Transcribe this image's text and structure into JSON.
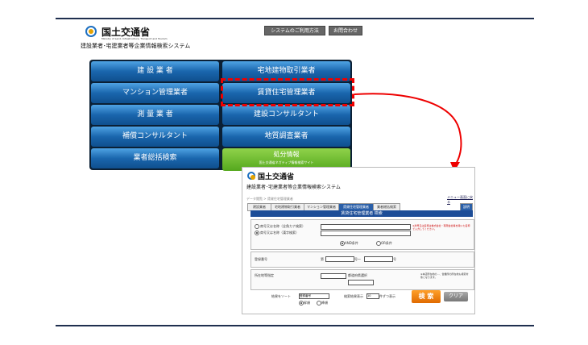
{
  "header": {
    "ministry_name": "国土交通省",
    "ministry_en": "Ministry of Land, Infrastructure, Transport and Tourism",
    "system_name": "建設業者･宅建業者等企業情報検索システム",
    "btn_usage": "システムのご利用方法",
    "btn_contact": "お問合わせ"
  },
  "menu": [
    {
      "label": "建 設 業 者"
    },
    {
      "label": "宅地建物取引業者"
    },
    {
      "label": "マンション管理業者"
    },
    {
      "label": "賃貸住宅管理業者"
    },
    {
      "label": "測 量 業 者"
    },
    {
      "label": "建設コンサルタント"
    },
    {
      "label": "補償コンサルタント"
    },
    {
      "label": "地質調査業者"
    },
    {
      "label": "業者総括検索"
    }
  ],
  "disposal": {
    "title": "処分情報",
    "sub": "国土交通省ネガティブ情報検索サイト"
  },
  "shot": {
    "ministry_name": "国土交通省",
    "system_name": "建設業者･宅建業者等企業情報検索システム",
    "menu_link": "メニュー画面に戻る",
    "breadcrumb": "データ閲覧 > 賃貸住宅管理業者",
    "tabs": [
      "建設業者",
      "宅地建物取引業者",
      "マンション管理業者",
      "賃貸住宅管理業者",
      "業者総括検索"
    ],
    "guide": "説明",
    "title_bar": "賃貸住宅管理業者 検索",
    "opt_kana": "商号又は名称（全角カナ検索）",
    "opt_kanji": "商号又は名称（漢字検索）",
    "note": "※商号又は名称は株式会社・有限会社等を除いた名称で入力してください。",
    "and_label": "AND条件",
    "or_label": "OR条件",
    "reg_label": "登録番号",
    "reg_prefix": "第",
    "reg_mid": "号～",
    "reg_suffix": "号",
    "loc_label": "所在地等指定",
    "pref_label": "都道府県選択",
    "loc_note": "※本店所在地の…、営業所の所在地も検索対象となります。",
    "sort_label": "結果をソート",
    "sort_value": "登録番号",
    "asc_label": "昇順",
    "desc_label": "降順",
    "count_label": "検索結果表示",
    "count_value": "10",
    "count_suffix": "件ずつ表示",
    "search_btn": "検 索",
    "clear_btn": "クリア"
  }
}
